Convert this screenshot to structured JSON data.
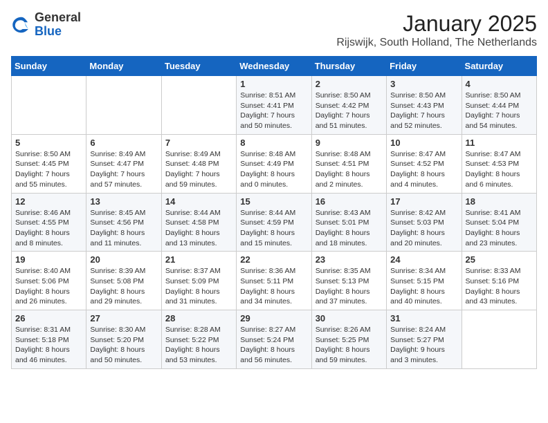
{
  "logo": {
    "general": "General",
    "blue": "Blue"
  },
  "title": "January 2025",
  "subtitle": "Rijswijk, South Holland, The Netherlands",
  "days_of_week": [
    "Sunday",
    "Monday",
    "Tuesday",
    "Wednesday",
    "Thursday",
    "Friday",
    "Saturday"
  ],
  "weeks": [
    [
      {
        "day": "",
        "content": ""
      },
      {
        "day": "",
        "content": ""
      },
      {
        "day": "",
        "content": ""
      },
      {
        "day": "1",
        "content": "Sunrise: 8:51 AM\nSunset: 4:41 PM\nDaylight: 7 hours\nand 50 minutes."
      },
      {
        "day": "2",
        "content": "Sunrise: 8:50 AM\nSunset: 4:42 PM\nDaylight: 7 hours\nand 51 minutes."
      },
      {
        "day": "3",
        "content": "Sunrise: 8:50 AM\nSunset: 4:43 PM\nDaylight: 7 hours\nand 52 minutes."
      },
      {
        "day": "4",
        "content": "Sunrise: 8:50 AM\nSunset: 4:44 PM\nDaylight: 7 hours\nand 54 minutes."
      }
    ],
    [
      {
        "day": "5",
        "content": "Sunrise: 8:50 AM\nSunset: 4:45 PM\nDaylight: 7 hours\nand 55 minutes."
      },
      {
        "day": "6",
        "content": "Sunrise: 8:49 AM\nSunset: 4:47 PM\nDaylight: 7 hours\nand 57 minutes."
      },
      {
        "day": "7",
        "content": "Sunrise: 8:49 AM\nSunset: 4:48 PM\nDaylight: 7 hours\nand 59 minutes."
      },
      {
        "day": "8",
        "content": "Sunrise: 8:48 AM\nSunset: 4:49 PM\nDaylight: 8 hours\nand 0 minutes."
      },
      {
        "day": "9",
        "content": "Sunrise: 8:48 AM\nSunset: 4:51 PM\nDaylight: 8 hours\nand 2 minutes."
      },
      {
        "day": "10",
        "content": "Sunrise: 8:47 AM\nSunset: 4:52 PM\nDaylight: 8 hours\nand 4 minutes."
      },
      {
        "day": "11",
        "content": "Sunrise: 8:47 AM\nSunset: 4:53 PM\nDaylight: 8 hours\nand 6 minutes."
      }
    ],
    [
      {
        "day": "12",
        "content": "Sunrise: 8:46 AM\nSunset: 4:55 PM\nDaylight: 8 hours\nand 8 minutes."
      },
      {
        "day": "13",
        "content": "Sunrise: 8:45 AM\nSunset: 4:56 PM\nDaylight: 8 hours\nand 11 minutes."
      },
      {
        "day": "14",
        "content": "Sunrise: 8:44 AM\nSunset: 4:58 PM\nDaylight: 8 hours\nand 13 minutes."
      },
      {
        "day": "15",
        "content": "Sunrise: 8:44 AM\nSunset: 4:59 PM\nDaylight: 8 hours\nand 15 minutes."
      },
      {
        "day": "16",
        "content": "Sunrise: 8:43 AM\nSunset: 5:01 PM\nDaylight: 8 hours\nand 18 minutes."
      },
      {
        "day": "17",
        "content": "Sunrise: 8:42 AM\nSunset: 5:03 PM\nDaylight: 8 hours\nand 20 minutes."
      },
      {
        "day": "18",
        "content": "Sunrise: 8:41 AM\nSunset: 5:04 PM\nDaylight: 8 hours\nand 23 minutes."
      }
    ],
    [
      {
        "day": "19",
        "content": "Sunrise: 8:40 AM\nSunset: 5:06 PM\nDaylight: 8 hours\nand 26 minutes."
      },
      {
        "day": "20",
        "content": "Sunrise: 8:39 AM\nSunset: 5:08 PM\nDaylight: 8 hours\nand 29 minutes."
      },
      {
        "day": "21",
        "content": "Sunrise: 8:37 AM\nSunset: 5:09 PM\nDaylight: 8 hours\nand 31 minutes."
      },
      {
        "day": "22",
        "content": "Sunrise: 8:36 AM\nSunset: 5:11 PM\nDaylight: 8 hours\nand 34 minutes."
      },
      {
        "day": "23",
        "content": "Sunrise: 8:35 AM\nSunset: 5:13 PM\nDaylight: 8 hours\nand 37 minutes."
      },
      {
        "day": "24",
        "content": "Sunrise: 8:34 AM\nSunset: 5:15 PM\nDaylight: 8 hours\nand 40 minutes."
      },
      {
        "day": "25",
        "content": "Sunrise: 8:33 AM\nSunset: 5:16 PM\nDaylight: 8 hours\nand 43 minutes."
      }
    ],
    [
      {
        "day": "26",
        "content": "Sunrise: 8:31 AM\nSunset: 5:18 PM\nDaylight: 8 hours\nand 46 minutes."
      },
      {
        "day": "27",
        "content": "Sunrise: 8:30 AM\nSunset: 5:20 PM\nDaylight: 8 hours\nand 50 minutes."
      },
      {
        "day": "28",
        "content": "Sunrise: 8:28 AM\nSunset: 5:22 PM\nDaylight: 8 hours\nand 53 minutes."
      },
      {
        "day": "29",
        "content": "Sunrise: 8:27 AM\nSunset: 5:24 PM\nDaylight: 8 hours\nand 56 minutes."
      },
      {
        "day": "30",
        "content": "Sunrise: 8:26 AM\nSunset: 5:25 PM\nDaylight: 8 hours\nand 59 minutes."
      },
      {
        "day": "31",
        "content": "Sunrise: 8:24 AM\nSunset: 5:27 PM\nDaylight: 9 hours\nand 3 minutes."
      },
      {
        "day": "",
        "content": ""
      }
    ]
  ]
}
